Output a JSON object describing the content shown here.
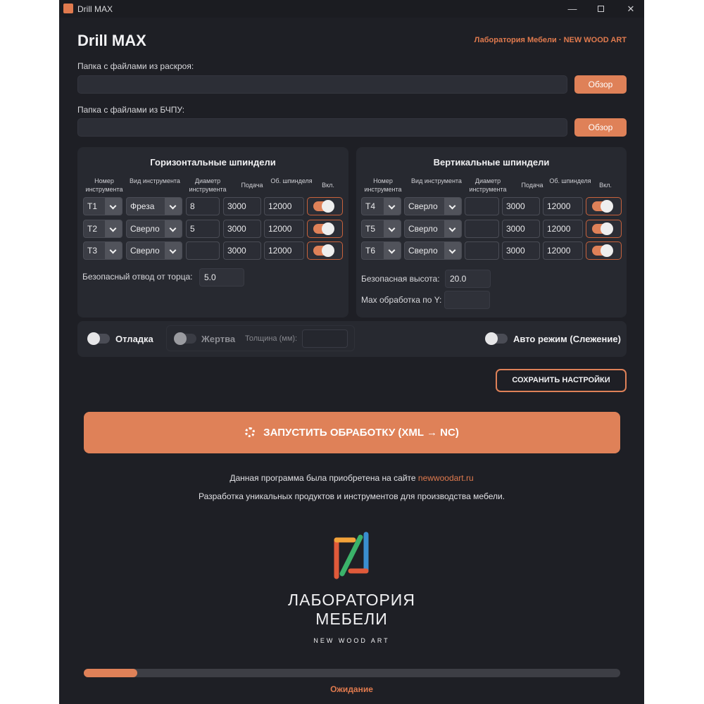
{
  "window": {
    "title": "Drill MAX",
    "controls": {
      "minimize": "—",
      "maximize": "□",
      "close": "✕"
    }
  },
  "header": {
    "app_title": "Drill MAX",
    "brand": "Лаборатория Мебели · NEW WOOD ART"
  },
  "folders": {
    "cut": {
      "label": "Папка с файлами из раскроя:",
      "value": "",
      "browse": "Обзор"
    },
    "cnc": {
      "label": "Папка с файлами из БЧПУ:",
      "value": "",
      "browse": "Обзор"
    }
  },
  "columns": {
    "tool_no": "Номер инструмента",
    "tool_type": "Вид инструмента",
    "diameter": "Диаметр инструмента",
    "feed": "Подача",
    "rpm": "Об. шпинделя",
    "enabled": "Вкл."
  },
  "horizontal": {
    "title": "Горизонтальные шпиндели",
    "rows": [
      {
        "tool": "T1",
        "type": "Фреза",
        "diameter": "8",
        "feed": "3000",
        "rpm": "12000",
        "enabled": true
      },
      {
        "tool": "T2",
        "type": "Сверло",
        "diameter": "5",
        "feed": "3000",
        "rpm": "12000",
        "enabled": true
      },
      {
        "tool": "T3",
        "type": "Сверло",
        "diameter": "",
        "feed": "3000",
        "rpm": "12000",
        "enabled": true
      }
    ],
    "safe_label": "Безопасный отвод от торца:",
    "safe_value": "5.0"
  },
  "vertical": {
    "title": "Вертикальные шпиндели",
    "rows": [
      {
        "tool": "T4",
        "type": "Сверло",
        "diameter": "",
        "feed": "3000",
        "rpm": "12000",
        "enabled": true
      },
      {
        "tool": "T5",
        "type": "Сверло",
        "diameter": "",
        "feed": "3000",
        "rpm": "12000",
        "enabled": true
      },
      {
        "tool": "T6",
        "type": "Сверло",
        "diameter": "",
        "feed": "3000",
        "rpm": "12000",
        "enabled": true
      }
    ],
    "safe_height_label": "Безопасная высота:",
    "safe_height_value": "20.0",
    "max_y_label": "Max обработка по Y:",
    "max_y_value": ""
  },
  "options": {
    "debug": {
      "label": "Отладка",
      "enabled": false
    },
    "victim": {
      "label": "Жертва",
      "enabled": false,
      "thickness_label": "Толщина (мм):",
      "thickness_value": ""
    },
    "auto": {
      "label": "Авто режим (Слежение)",
      "enabled": false
    }
  },
  "actions": {
    "save": "СОХРАНИТЬ НАСТРОЙКИ",
    "run": "ЗАПУСТИТЬ ОБРАБОТКУ  (XML → NC)"
  },
  "info": {
    "purchase_text": "Данная программа была приобретена на сайте ",
    "purchase_link": "newwoodart.ru",
    "dev_text": "Разработка уникальных продуктов и инструментов для производства мебели."
  },
  "logo": {
    "line1": "ЛАБОРАТОРИЯ",
    "line2": "МЕБЕЛИ",
    "line3": "NEW WOOD ART"
  },
  "progress": {
    "value_percent": 10,
    "status": "Ожидание"
  },
  "colors": {
    "accent": "#df8158",
    "background": "#1e1f25",
    "panel": "#272930"
  }
}
